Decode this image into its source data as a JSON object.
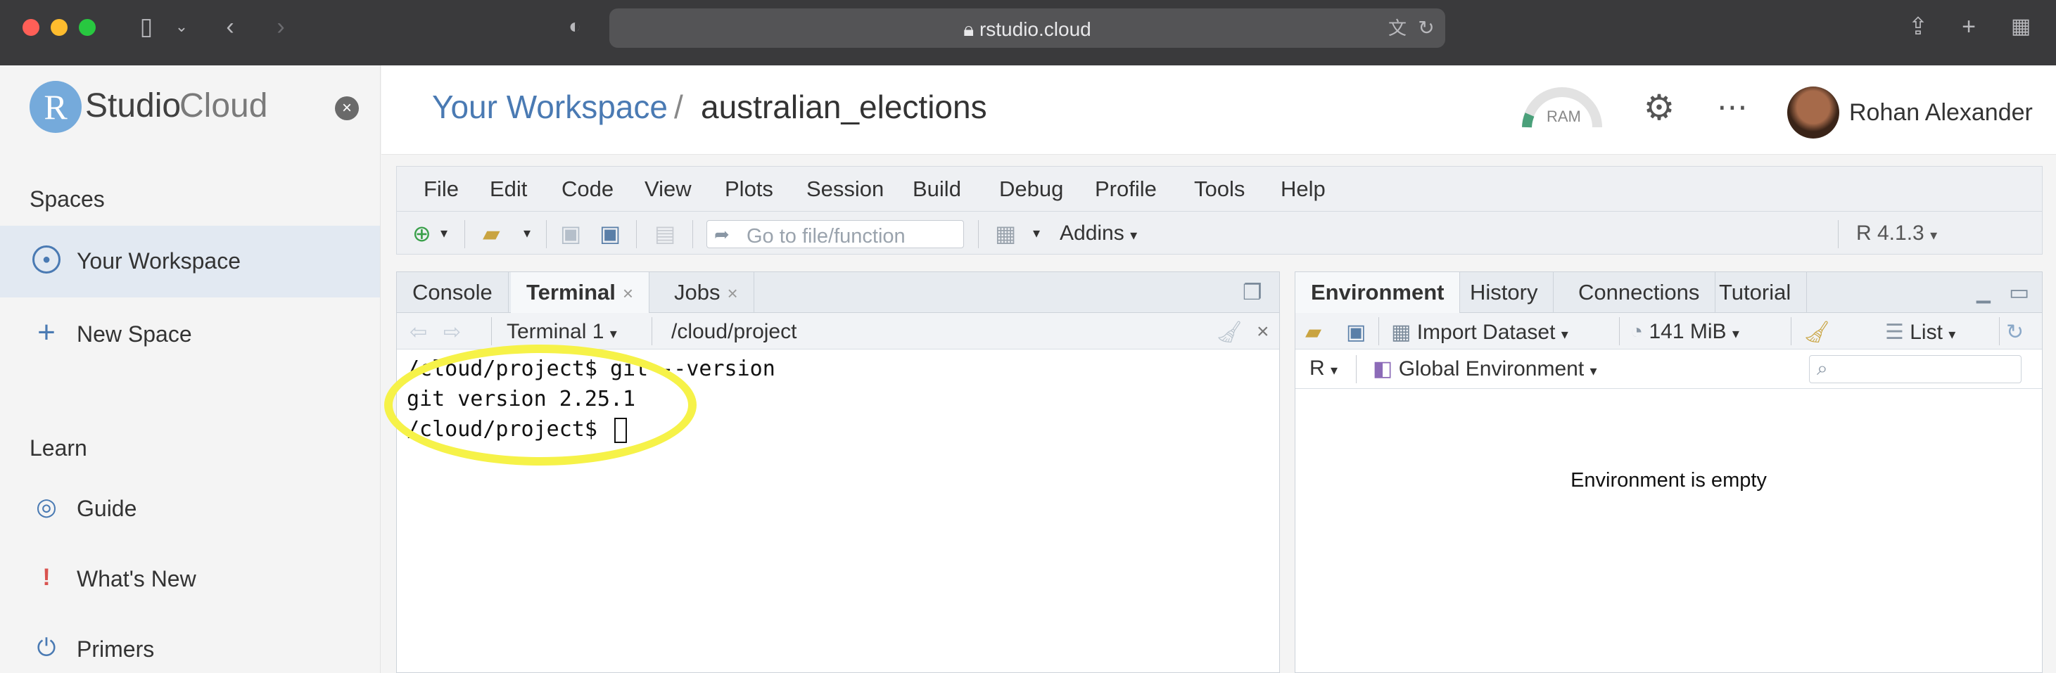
{
  "browser": {
    "url": "rstudio.cloud"
  },
  "sidebar": {
    "logo_r": "R",
    "logo_studio": "Studio",
    "logo_cloud": "Cloud",
    "spaces_heading": "Spaces",
    "spaces_items": [
      {
        "label": "Your Workspace",
        "icon": "user-icon",
        "active": true
      },
      {
        "label": "New Space",
        "icon": "plus-icon",
        "active": false
      }
    ],
    "learn_heading": "Learn",
    "learn_items": [
      {
        "label": "Guide",
        "icon": "compass-icon"
      },
      {
        "label": "What's New",
        "icon": "exclamation-icon"
      },
      {
        "label": "Primers",
        "icon": "power-icon"
      }
    ]
  },
  "header": {
    "workspace": "Your Workspace",
    "separator": "/",
    "project": "australian_elections",
    "ram_label": "RAM",
    "user_name": "Rohan Alexander"
  },
  "ide": {
    "menu": [
      "File",
      "Edit",
      "Code",
      "View",
      "Plots",
      "Session",
      "Build",
      "Debug",
      "Profile",
      "Tools",
      "Help"
    ],
    "toolbar": {
      "goto_placeholder": "Go to file/function",
      "addins": "Addins",
      "r_version": "R 4.1.3"
    },
    "left_pane": {
      "tabs": [
        "Console",
        "Terminal",
        "Jobs"
      ],
      "active_tab": "Terminal",
      "terminal_selector": "Terminal 1",
      "path": "/cloud/project",
      "lines": [
        "/cloud/project$ git --version",
        "git version 2.25.1",
        "/cloud/project$ "
      ]
    },
    "right_pane": {
      "tabs": [
        "Environment",
        "History",
        "Connections",
        "Tutorial"
      ],
      "active_tab": "Environment",
      "import_dataset": "Import Dataset",
      "memory": "141 MiB",
      "view_mode": "List",
      "language": "R",
      "scope": "Global Environment",
      "empty_message": "Environment is empty"
    }
  },
  "colors": {
    "accent": "#4a7ab3",
    "highlight_circle": "#f6f248"
  }
}
